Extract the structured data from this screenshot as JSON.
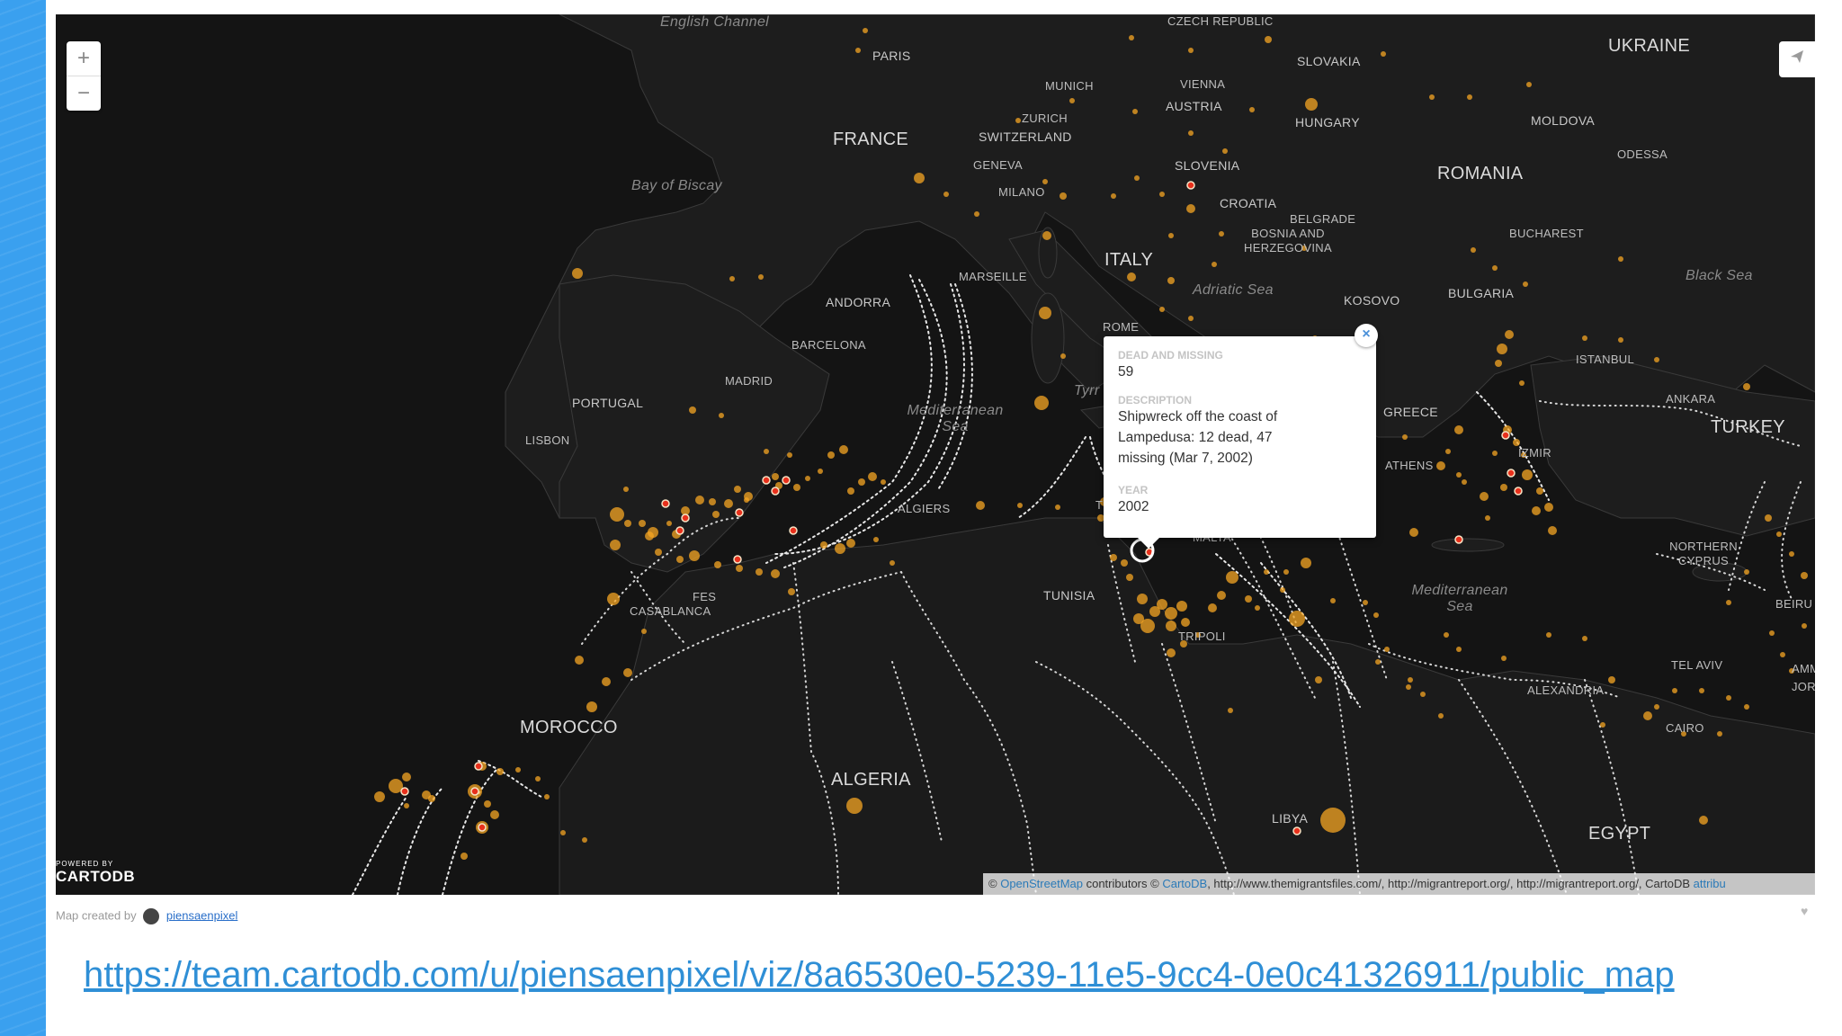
{
  "map": {
    "labels": {
      "english_channel": "English Channel",
      "paris": "PARIS",
      "france": "FRANCE",
      "bay_of_biscay": "Bay of Biscay",
      "czech_republic": "CZECH REPUBLIC",
      "slovakia": "SLOVAKIA",
      "ukraine": "UKRAINE",
      "munich": "MUNICH",
      "vienna": "VIENNA",
      "austria": "AUSTRIA",
      "hungary": "HUNGARY",
      "moldova": "MOLDOVA",
      "odessa": "ODESSA",
      "zurich": "ZURICH",
      "switzerland": "SWITZERLAND",
      "geneva": "GENEVA",
      "milano": "MILANO",
      "slovenia": "SLOVENIA",
      "romania": "ROMANIA",
      "croatia": "CROATIA",
      "belgrade": "BELGRADE",
      "bosnia": "BOSNIA AND HERZEGOVINA",
      "bucharest": "BUCHAREST",
      "italy": "ITALY",
      "marseille": "MARSEILLE",
      "adriatic": "Adriatic Sea",
      "kosovo": "KOSOVO",
      "bulgaria": "BULGARIA",
      "black_sea": "Black Sea",
      "andorra": "ANDORRA",
      "rome": "ROME",
      "barcelona": "BARCELONA",
      "istanbul": "ISTANBUL",
      "madrid": "MADRID",
      "portugal": "PORTUGAL",
      "tyrrhenian": "Tyrr",
      "mediterranean_west": "Mediterranean Sea",
      "greece": "GREECE",
      "ankara": "ANKARA",
      "lisbon": "LISBON",
      "turkey": "TURKEY",
      "izmir": "IZMIR",
      "athens": "ATHENS",
      "algiers": "ALGIERS",
      "tunis": "TU",
      "malta": "MALTA",
      "northern_cyprus": "NORTHERN CYPRUS",
      "fes": "FES",
      "casablanca": "CASABLANCA",
      "tunisia": "TUNISIA",
      "mediterranean_east": "Mediterranean Sea",
      "beirut": "BEIRU",
      "tripoli": "TRIPOLI",
      "tel_aviv": "TEL AVIV",
      "amman": "AMM",
      "jordan": "JORD",
      "alexandria": "ALEXANDRIA",
      "morocco": "MOROCCO",
      "cairo": "CAIRO",
      "algeria": "ALGERIA",
      "libya": "LIBYA",
      "egypt": "EGYPT"
    },
    "zoom_in": "+",
    "zoom_out": "−",
    "share_icon": "paper-plane-icon",
    "logo_powered": "POWERED BY",
    "logo_name": "CARTODB",
    "attribution": {
      "prefix": "© ",
      "osm": "OpenStreetMap",
      "mid": " contributors © ",
      "cartodb": "CartoDB",
      "sources": ", http://www.themigrantsfiles.com/, http://migrantreport.org/, http://migrantreport.org/, CartoDB ",
      "attrib": "attribu"
    },
    "colors": {
      "background": "#121212",
      "point_outer": "#f5a623",
      "point_hot": "#e8301c",
      "route": "#e8e8e8"
    }
  },
  "popup": {
    "close": "×",
    "dead_label": "DEAD AND MISSING",
    "dead_value": "59",
    "desc_label": "DESCRIPTION",
    "desc_line1": "Shipwreck off the coast of",
    "desc_line2": "Lampedusa: 12 dead, 47",
    "desc_line3": "missing (Mar 7, 2002)",
    "year_label": "YEAR",
    "year_value": "2002"
  },
  "credit": {
    "text": "Map created by",
    "user": "piensaenpixel"
  },
  "url": "https://team.cartodb.com/u/piensaenpixel/viz/8a6530e0-5239-11e5-9cc4-0e0c41326911/public_map"
}
